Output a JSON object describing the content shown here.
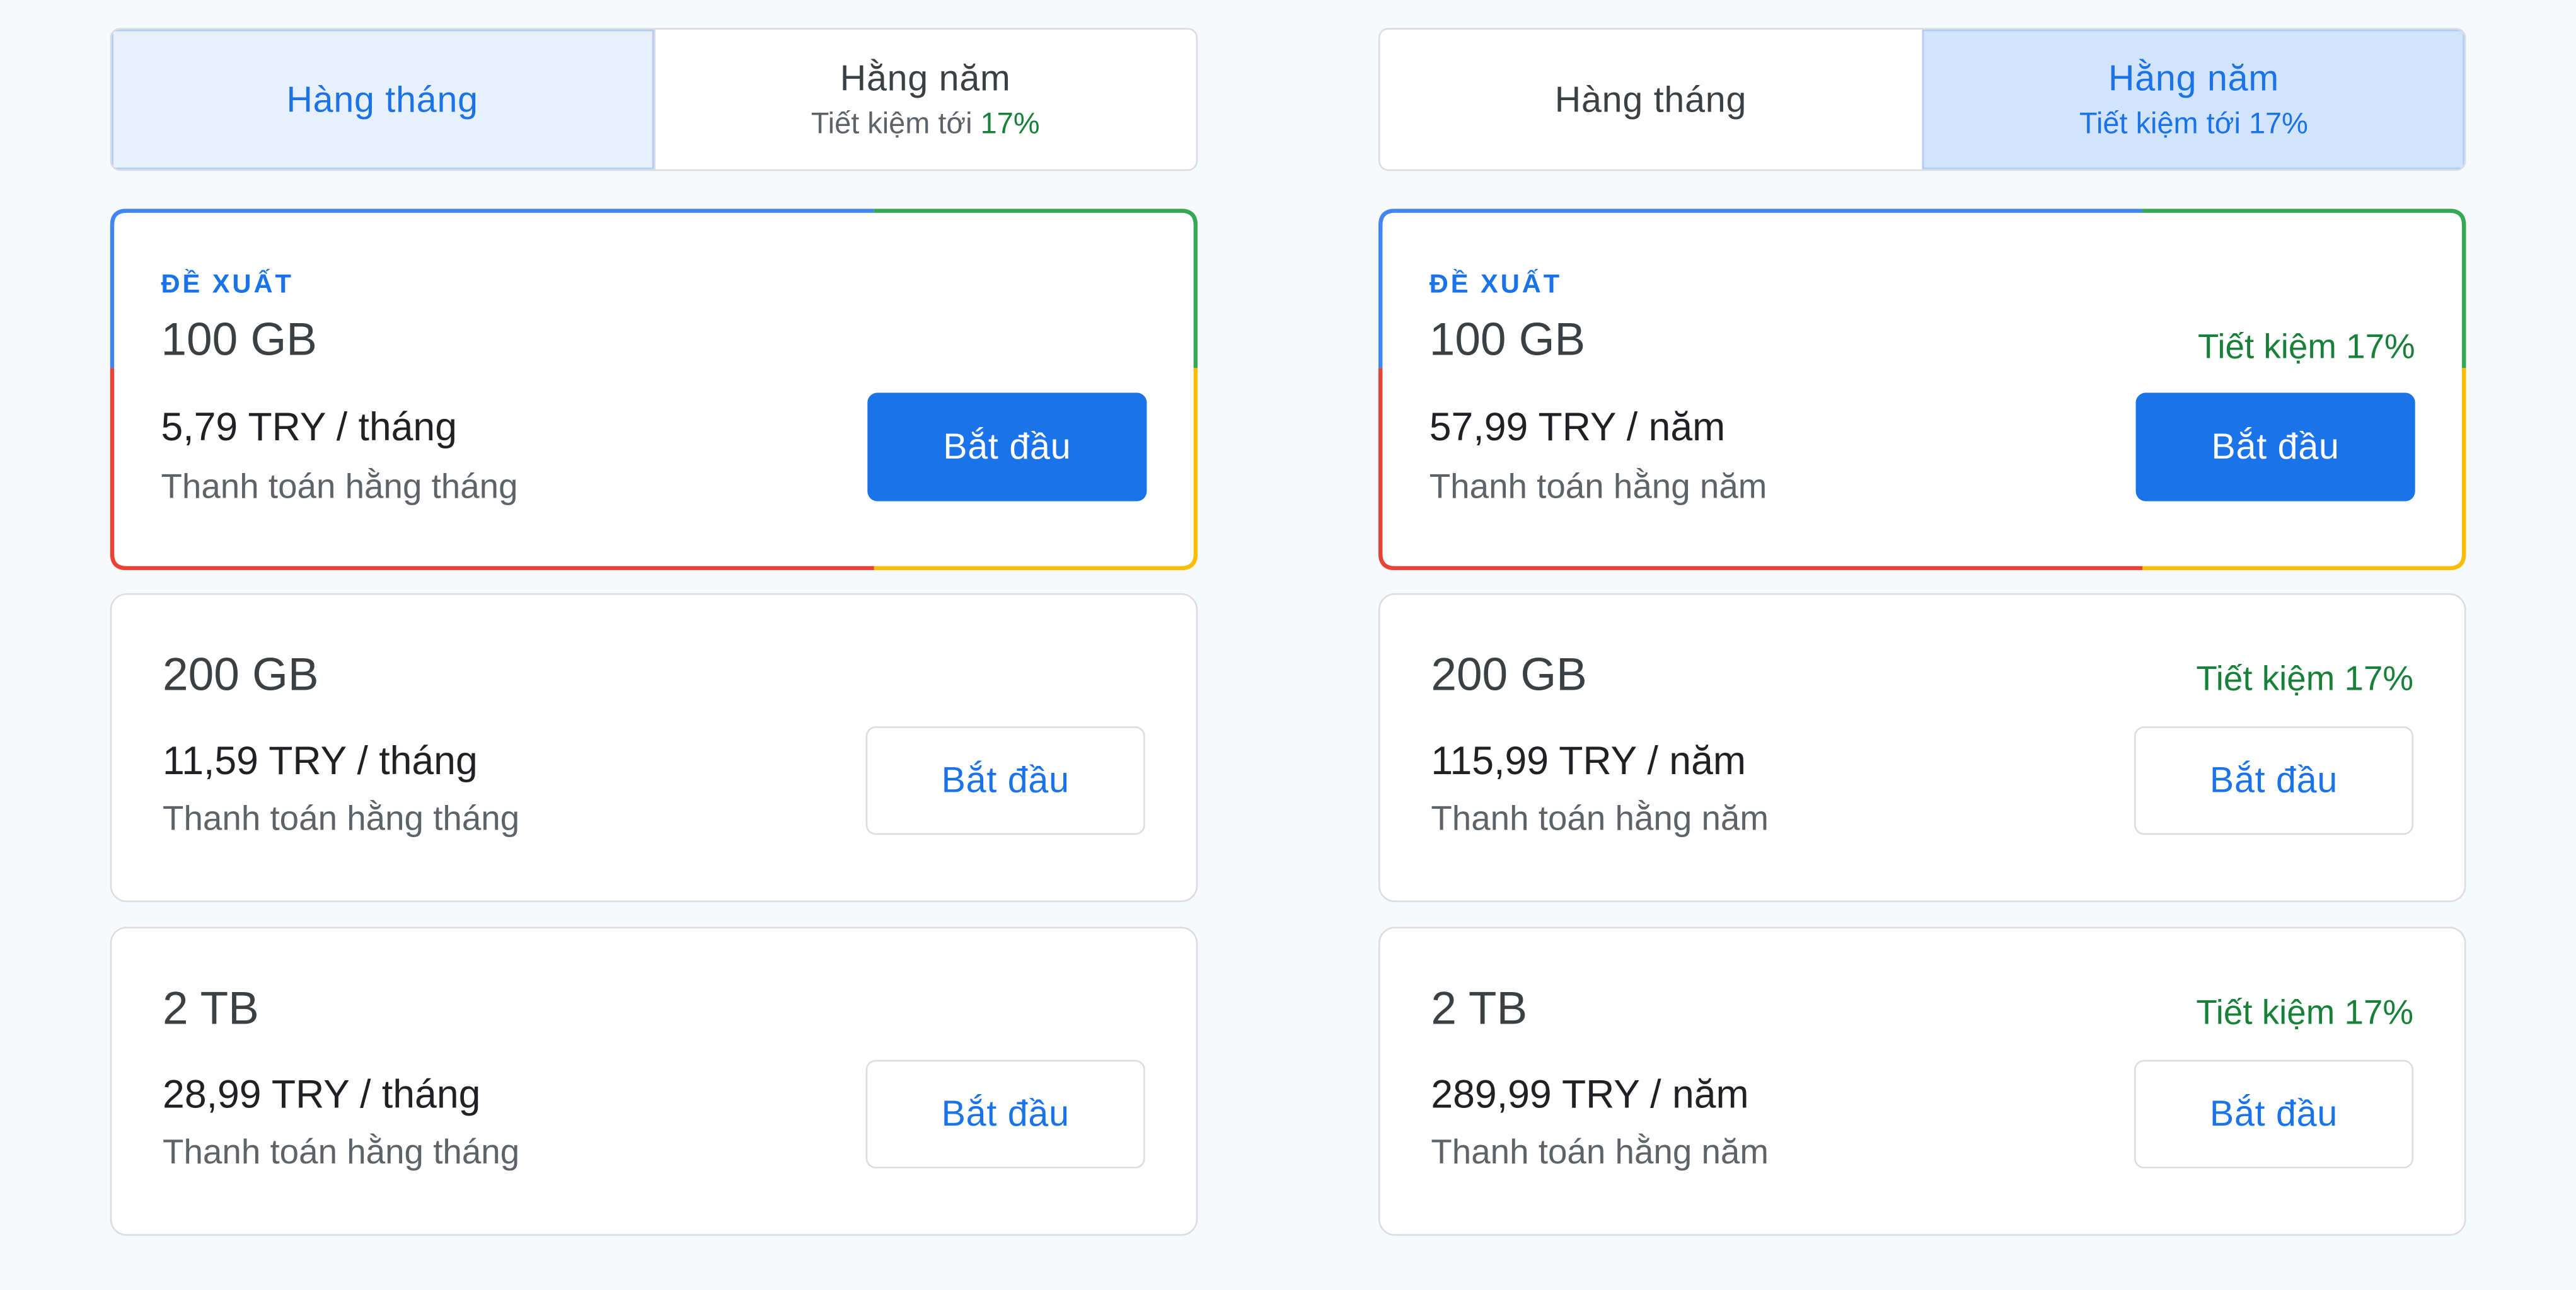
{
  "colors": {
    "accent": "#1a73e8",
    "save_green": "#188038",
    "google_blue": "#4285f4",
    "google_green": "#34a853",
    "google_yellow": "#fbbc04",
    "google_red": "#ea4335"
  },
  "monthly_view": {
    "toggle": {
      "monthly": {
        "label": "Hàng tháng"
      },
      "yearly": {
        "label": "Hằng năm",
        "sub_prefix": "Tiết kiệm tới ",
        "sub_pct": "17%"
      },
      "selected": "monthly"
    },
    "plans": [
      {
        "badge": "ĐỀ XUẤT",
        "size": "100 GB",
        "price": "5,79 TRY / tháng",
        "billing": "Thanh toán hằng tháng",
        "button": "Bắt đầu"
      },
      {
        "size": "200 GB",
        "price": "11,59 TRY / tháng",
        "billing": "Thanh toán hằng tháng",
        "button": "Bắt đầu"
      },
      {
        "size": "2 TB",
        "price": "28,99 TRY / tháng",
        "billing": "Thanh toán hằng tháng",
        "button": "Bắt đầu"
      }
    ]
  },
  "yearly_view": {
    "toggle": {
      "monthly": {
        "label": "Hàng tháng"
      },
      "yearly": {
        "label": "Hằng năm",
        "sub_prefix": "Tiết kiệm tới ",
        "sub_pct": "17%"
      },
      "selected": "yearly"
    },
    "plans": [
      {
        "badge": "ĐỀ XUẤT",
        "size": "100 GB",
        "savings": "Tiết kiệm 17%",
        "price": "57,99 TRY / năm",
        "billing": "Thanh toán hằng năm",
        "button": "Bắt đầu"
      },
      {
        "size": "200 GB",
        "savings": "Tiết kiệm 17%",
        "price": "115,99 TRY / năm",
        "billing": "Thanh toán hằng năm",
        "button": "Bắt đầu"
      },
      {
        "size": "2 TB",
        "savings": "Tiết kiệm 17%",
        "price": "289,99 TRY / năm",
        "billing": "Thanh toán hằng năm",
        "button": "Bắt đầu"
      }
    ]
  }
}
